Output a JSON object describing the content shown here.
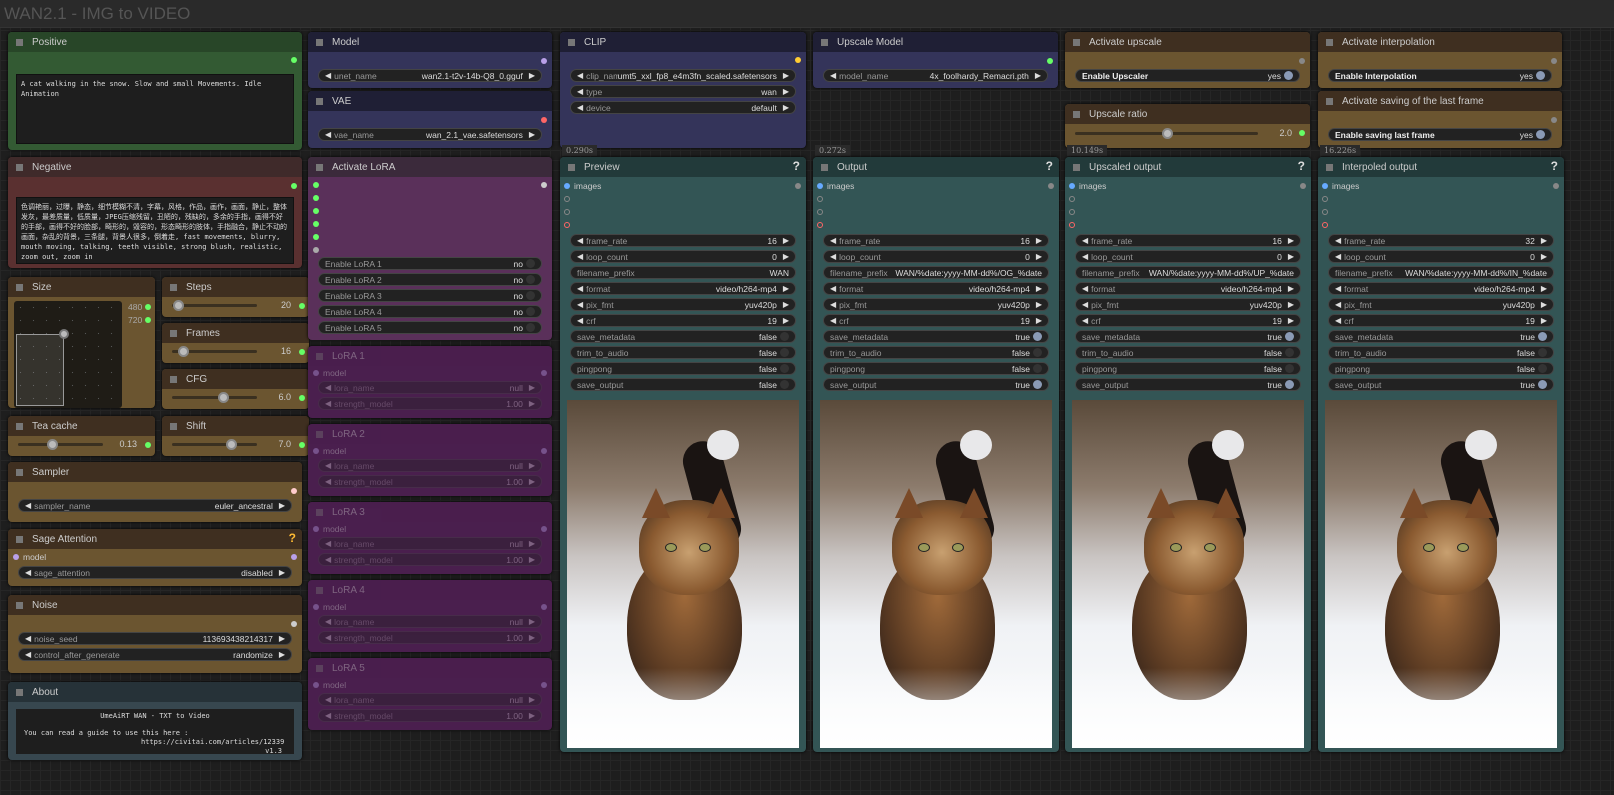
{
  "group_title": "WAN2.1 - IMG to VIDEO",
  "colors": {
    "slot_green": "#6f6",
    "slot_purple": "#b9a0e8",
    "slot_red": "#f66",
    "slot_yellow": "#fc3",
    "slot_grey": "#888"
  },
  "nodes": {
    "positive": {
      "title": "Positive",
      "text": "A cat walking in the snow. Slow and small Movements. Idle Animation"
    },
    "negative": {
      "title": "Negative",
      "text": "色调艳丽，过曝，静态，细节模糊不清，字幕，风格，作品，画作，画面，静止，整体发灰，最差质量，低质量，JPEG压缩残留，丑陋的，残缺的，多余的手指，画得不好的手部，画得不好的脸部，畸形的，毁容的，形态畸形的肢体，手指融合，静止不动的画面，杂乱的背景，三条腿，背景人很多，倒着走, fast movements, blurry, mouth moving, talking, teeth visible, strong blush, realistic, zoom out, zoom in"
    },
    "size": {
      "title": "Size",
      "width": "480",
      "height": "720"
    },
    "steps": {
      "title": "Steps",
      "value": "20",
      "level": 0.07
    },
    "frames": {
      "title": "Frames",
      "value": "16",
      "level": 0.13
    },
    "cfg": {
      "title": "CFG",
      "value": "6.0",
      "level": 0.6
    },
    "teacache": {
      "title": "Tea cache",
      "value": "0.13",
      "level": 0.4
    },
    "shift": {
      "title": "Shift",
      "value": "7.0",
      "level": 0.7
    },
    "sampler": {
      "title": "Sampler",
      "widgets": [
        {
          "kind": "combo",
          "label": "sampler_name",
          "value": "euler_ancestral"
        }
      ]
    },
    "sage": {
      "title": "Sage Attention",
      "help": "?",
      "input": "model",
      "widgets": [
        {
          "kind": "combo",
          "label": "sage_attention",
          "value": "disabled"
        }
      ]
    },
    "noise": {
      "title": "Noise",
      "widgets": [
        {
          "kind": "combo",
          "label": "noise_seed",
          "value": "113693438214317"
        },
        {
          "kind": "combo",
          "label": "control_after_generate",
          "value": "randomize"
        }
      ]
    },
    "about": {
      "title": "About",
      "line1": "UmeAiRT WAN - TXT to Video",
      "line2": "You can read a guide to use this here :",
      "line3": "https://civitai.com/articles/12339",
      "line4": "v1.3"
    },
    "model": {
      "title": "Model",
      "widgets": [
        {
          "kind": "combo",
          "label": "unet_name",
          "value": "wan2.1-t2v-14b-Q8_0.gguf"
        }
      ]
    },
    "vae": {
      "title": "VAE",
      "widgets": [
        {
          "kind": "combo",
          "label": "vae_name",
          "value": "wan_2.1_vae.safetensors"
        }
      ]
    },
    "clip": {
      "title": "CLIP",
      "time": "0.290s",
      "widgets": [
        {
          "kind": "combo",
          "label": "clip_name",
          "value": "umt5_xxl_fp8_e4m3fn_scaled.safetensors"
        },
        {
          "kind": "combo",
          "label": "type",
          "value": "wan"
        },
        {
          "kind": "combo",
          "label": "device",
          "value": "default"
        }
      ]
    },
    "upscale_model": {
      "title": "Upscale Model",
      "time": "0.272s",
      "widgets": [
        {
          "kind": "combo",
          "label": "model_name",
          "value": "4x_foolhardy_Remacri.pth"
        }
      ]
    },
    "activate_upscale": {
      "title": "Activate upscale",
      "widgets": [
        {
          "kind": "bool",
          "label": "Enable Upscaler",
          "value": "yes",
          "on": true
        }
      ]
    },
    "upscale_ratio": {
      "title": "Upscale ratio",
      "time": "10.149s",
      "value": "2.0",
      "level": 0.5
    },
    "activate_interp": {
      "title": "Activate interpolation",
      "widgets": [
        {
          "kind": "bool",
          "label": "Enable Interpolation",
          "value": "yes",
          "on": true
        }
      ]
    },
    "activate_save": {
      "title": "Activate saving of the last frame",
      "time": "16.226s",
      "widgets": [
        {
          "kind": "bool",
          "label": "Enable saving last frame",
          "value": "yes",
          "on": true
        }
      ]
    },
    "activate_lora": {
      "title": "Activate LoRA",
      "widgets": [
        {
          "kind": "toggle",
          "label": "Enable LoRA 1",
          "value": "no",
          "on": false
        },
        {
          "kind": "toggle",
          "label": "Enable LoRA 2",
          "value": "no",
          "on": false
        },
        {
          "kind": "toggle",
          "label": "Enable LoRA 3",
          "value": "no",
          "on": false
        },
        {
          "kind": "toggle",
          "label": "Enable LoRA 4",
          "value": "no",
          "on": false
        },
        {
          "kind": "toggle",
          "label": "Enable LoRA 5",
          "value": "no",
          "on": false
        }
      ]
    },
    "loras": [
      {
        "title": "LoRA 1",
        "input": "model",
        "widgets": [
          {
            "kind": "combo",
            "label": "lora_name",
            "value": "null"
          },
          {
            "kind": "combo",
            "label": "strength_model",
            "value": "1.00"
          }
        ]
      },
      {
        "title": "LoRA 2",
        "input": "model",
        "widgets": [
          {
            "kind": "combo",
            "label": "lora_name",
            "value": "null"
          },
          {
            "kind": "combo",
            "label": "strength_model",
            "value": "1.00"
          }
        ]
      },
      {
        "title": "LoRA 3",
        "input": "model",
        "widgets": [
          {
            "kind": "combo",
            "label": "lora_name",
            "value": "null"
          },
          {
            "kind": "combo",
            "label": "strength_model",
            "value": "1.00"
          }
        ]
      },
      {
        "title": "LoRA 4",
        "input": "model",
        "widgets": [
          {
            "kind": "combo",
            "label": "lora_name",
            "value": "null"
          },
          {
            "kind": "combo",
            "label": "strength_model",
            "value": "1.00"
          }
        ]
      },
      {
        "title": "LoRA 5",
        "input": "model",
        "widgets": [
          {
            "kind": "combo",
            "label": "lora_name",
            "value": "null"
          },
          {
            "kind": "combo",
            "label": "strength_model",
            "value": "1.00"
          }
        ]
      }
    ],
    "video": [
      {
        "title": "Preview",
        "help": "?",
        "input": "images",
        "widgets": [
          {
            "kind": "combo",
            "label": "frame_rate",
            "value": "16"
          },
          {
            "kind": "combo",
            "label": "loop_count",
            "value": "0"
          },
          {
            "kind": "text",
            "label": "filename_prefix",
            "value": "WAN"
          },
          {
            "kind": "combo",
            "label": "format",
            "value": "video/h264-mp4"
          },
          {
            "kind": "combo",
            "label": "pix_fmt",
            "value": "yuv420p"
          },
          {
            "kind": "combo",
            "label": "crf",
            "value": "19"
          },
          {
            "kind": "toggle",
            "label": "save_metadata",
            "value": "false",
            "on": false
          },
          {
            "kind": "toggle",
            "label": "trim_to_audio",
            "value": "false",
            "on": false
          },
          {
            "kind": "toggle",
            "label": "pingpong",
            "value": "false",
            "on": false
          },
          {
            "kind": "toggle",
            "label": "save_output",
            "value": "false",
            "on": false
          }
        ]
      },
      {
        "title": "Output",
        "help": "?",
        "input": "images",
        "widgets": [
          {
            "kind": "combo",
            "label": "frame_rate",
            "value": "16"
          },
          {
            "kind": "combo",
            "label": "loop_count",
            "value": "0"
          },
          {
            "kind": "text",
            "label": "filename_prefix",
            "value": "WAN/%date:yyyy-MM-dd%/OG_%date"
          },
          {
            "kind": "combo",
            "label": "format",
            "value": "video/h264-mp4"
          },
          {
            "kind": "combo",
            "label": "pix_fmt",
            "value": "yuv420p"
          },
          {
            "kind": "combo",
            "label": "crf",
            "value": "19"
          },
          {
            "kind": "toggle",
            "label": "save_metadata",
            "value": "true",
            "on": true
          },
          {
            "kind": "toggle",
            "label": "trim_to_audio",
            "value": "false",
            "on": false
          },
          {
            "kind": "toggle",
            "label": "pingpong",
            "value": "false",
            "on": false
          },
          {
            "kind": "toggle",
            "label": "save_output",
            "value": "true",
            "on": true
          }
        ]
      },
      {
        "title": "Upscaled output",
        "help": "?",
        "input": "images",
        "widgets": [
          {
            "kind": "combo",
            "label": "frame_rate",
            "value": "16"
          },
          {
            "kind": "combo",
            "label": "loop_count",
            "value": "0"
          },
          {
            "kind": "text",
            "label": "filename_prefix",
            "value": "WAN/%date:yyyy-MM-dd%/UP_%date"
          },
          {
            "kind": "combo",
            "label": "format",
            "value": "video/h264-mp4"
          },
          {
            "kind": "combo",
            "label": "pix_fmt",
            "value": "yuv420p"
          },
          {
            "kind": "combo",
            "label": "crf",
            "value": "19"
          },
          {
            "kind": "toggle",
            "label": "save_metadata",
            "value": "true",
            "on": true
          },
          {
            "kind": "toggle",
            "label": "trim_to_audio",
            "value": "false",
            "on": false
          },
          {
            "kind": "toggle",
            "label": "pingpong",
            "value": "false",
            "on": false
          },
          {
            "kind": "toggle",
            "label": "save_output",
            "value": "true",
            "on": true
          }
        ]
      },
      {
        "title": "Interpoled output",
        "help": "?",
        "input": "images",
        "widgets": [
          {
            "kind": "combo",
            "label": "frame_rate",
            "value": "32"
          },
          {
            "kind": "combo",
            "label": "loop_count",
            "value": "0"
          },
          {
            "kind": "text",
            "label": "filename_prefix",
            "value": "WAN/%date:yyyy-MM-dd%/IN_%date"
          },
          {
            "kind": "combo",
            "label": "format",
            "value": "video/h264-mp4"
          },
          {
            "kind": "combo",
            "label": "pix_fmt",
            "value": "yuv420p"
          },
          {
            "kind": "combo",
            "label": "crf",
            "value": "19"
          },
          {
            "kind": "toggle",
            "label": "save_metadata",
            "value": "true",
            "on": true
          },
          {
            "kind": "toggle",
            "label": "trim_to_audio",
            "value": "false",
            "on": false
          },
          {
            "kind": "toggle",
            "label": "pingpong",
            "value": "false",
            "on": false
          },
          {
            "kind": "toggle",
            "label": "save_output",
            "value": "true",
            "on": true
          }
        ]
      }
    ]
  }
}
